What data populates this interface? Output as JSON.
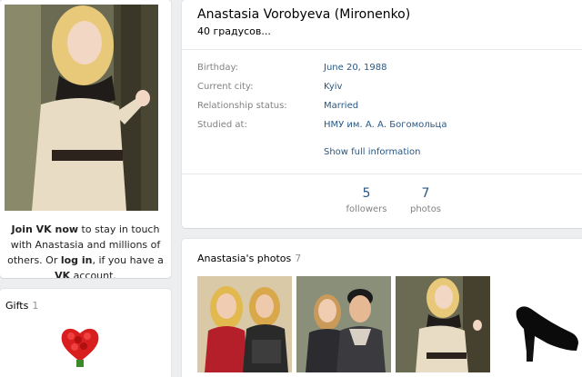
{
  "profile": {
    "name": "Anastasia Vorobyeva (Mironenko)",
    "status": "40 градусов...",
    "info": [
      {
        "label": "Birthday:",
        "value": "June 20, 1988"
      },
      {
        "label": "Current city:",
        "value": "Kyiv"
      },
      {
        "label": "Relationship status:",
        "value": "Married"
      },
      {
        "label": "Studied at:",
        "value": "НМУ им. А. А. Богомольца"
      }
    ],
    "show_more": "Show full information",
    "counters": [
      {
        "value": "5",
        "label": "followers"
      },
      {
        "value": "7",
        "label": "photos"
      }
    ]
  },
  "join": {
    "join_link": "Join VK now",
    "text1": " to stay in touch with Anastasia and millions of others. Or ",
    "login_link": "log in",
    "text2": ", if you have a ",
    "vk": "VK",
    "text3": " account."
  },
  "gifts": {
    "title": "Gifts",
    "count": "1"
  },
  "photos": {
    "title": "Anastasia's photos",
    "count": "7"
  },
  "colors": {
    "link": "#2a5885",
    "label": "#828282",
    "background": "#edeef0"
  }
}
